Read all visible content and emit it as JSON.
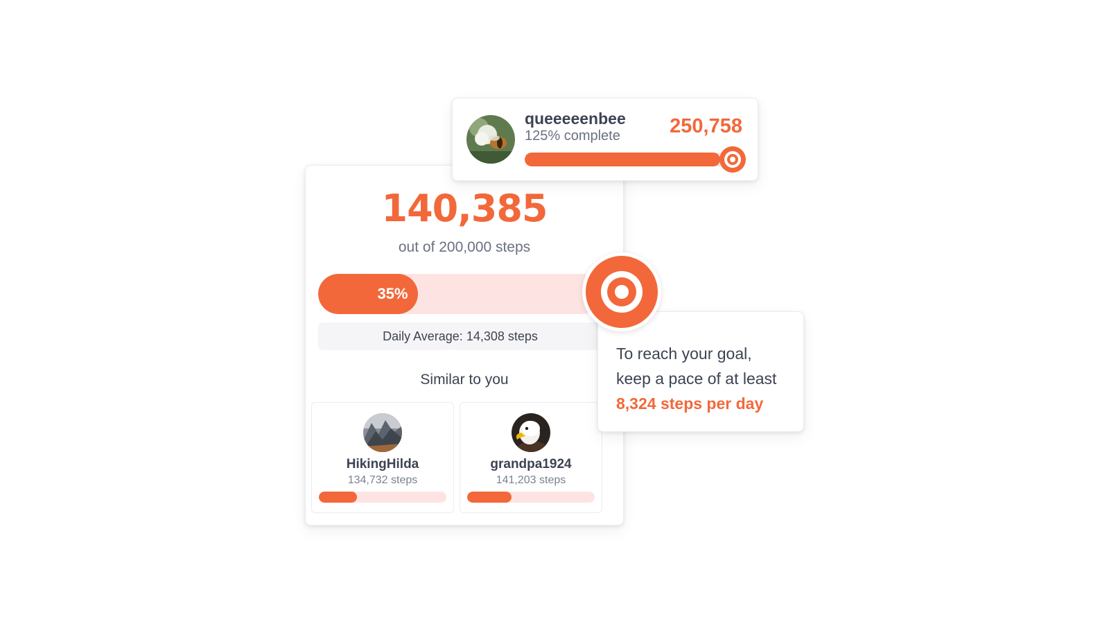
{
  "colors": {
    "accent": "#f2683a",
    "track": "#fde4e2",
    "text": "#3d4352",
    "muted": "#6b7080"
  },
  "featured_user": {
    "username": "queeeeenbee",
    "completion_text": "125% complete",
    "steps": "250,758",
    "progress_fraction": 0.94,
    "avatar_icon": "bee-on-flower-avatar",
    "goal_icon": "target-icon"
  },
  "summary": {
    "steps": "140,385",
    "goal_text": "out of 200,000 steps",
    "progress_label": "35%",
    "progress_fraction": 0.35,
    "daily_average": "Daily Average: 14,308 steps",
    "goal_icon": "target-icon"
  },
  "similar": {
    "title": "Similar to you",
    "users": [
      {
        "name": "HikingHilda",
        "steps": "134,732 steps",
        "progress_fraction": 0.3,
        "avatar_icon": "mountain-avatar"
      },
      {
        "name": "grandpa1924",
        "steps": "141,203 steps",
        "progress_fraction": 0.35,
        "avatar_icon": "eagle-avatar"
      }
    ]
  },
  "pace": {
    "line1": "To reach your goal,",
    "line2": "keep a pace of at least",
    "highlight": "8,324 steps per day"
  }
}
